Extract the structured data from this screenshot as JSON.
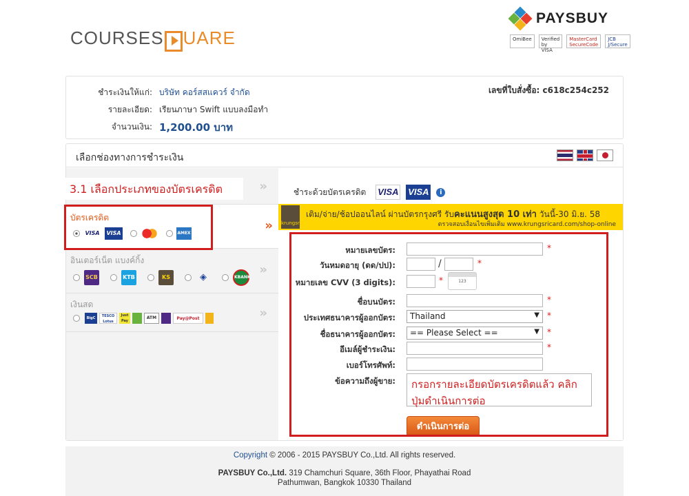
{
  "header": {
    "site_logo_main": "COURSES",
    "site_logo_rest": "UARE",
    "gateway_brand": "PAYSBUY",
    "badges": [
      "OmiBee",
      "Verified by VISA",
      "MasterCard SecureCode",
      "JCB J/Secure"
    ]
  },
  "order": {
    "payee_label": "ชำระเงินให้แก่:",
    "payee_value": "บริษัท คอร์สสแควร์ จำกัด",
    "detail_label": "รายละเอียด:",
    "detail_value": "เรียนภาษา Swift แบบลงมือทำ",
    "amount_label": "จำนวนเงิน:",
    "amount_value": "1,200.00 บาท",
    "order_no": "เลขที่ใบสั่งซื้อ: c618c254c252"
  },
  "panel": {
    "title": "เลือกช่องทางการชำระเงิน",
    "annotation_step": "3.1 เลือกประเภทของบัตรเครดิต",
    "credit_card_head": "บัตรเครดิต",
    "internet_banking_head": "อินเตอร์เน็ต แบงค์กิ้ง",
    "cash_head": "เงินสด",
    "card_logos": [
      "VISA",
      "VISA",
      "MC",
      "AMEX"
    ],
    "bank_logos": [
      "SCB",
      "KTB",
      "KS",
      "BBL",
      "KBANK"
    ],
    "cash_logos": [
      "BigC",
      "TESCO Lotus",
      "Just Pay",
      "ATM",
      "Pay@Post"
    ]
  },
  "content": {
    "pay_with": "ชำระด้วยบัตรเครดิต",
    "visa_label": "VISA",
    "banner_line1": "เติม/จ่าย/ช้อปออนไลน์ ผ่านบัตรกรุงศรี รับ",
    "banner_bold": "คะแนนสูงสุด 10 เท่า",
    "banner_line1_tail": " วันนี้-30 มิ.ย. 58",
    "banner_line2": "ตรวจสอบเงื่อนไขเพิ่มเติม www.krungsricard.com/shop-online",
    "banner_logo": "krungsri"
  },
  "form": {
    "card_number_label": "หมายเลขบัตร:",
    "expiry_label": "วันหมดอายุ (ดด/ปป):",
    "cvv_label": "หมายเลข CVV (3 digits):",
    "name_label": "ชื่อบนบัตร:",
    "issuer_country_label": "ประเทศธนาคารผู้ออกบัตร:",
    "issuer_country_value": "Thailand",
    "issuer_bank_label": "ชื่อธนาคารผู้ออกบัตร:",
    "issuer_bank_value": "== Please Select ==",
    "email_label": "อีเมล์ผู้ชำระเงิน:",
    "phone_label": "เบอร์โทรศัพท์:",
    "message_label": "ข้อความถึงผู้ขาย:",
    "annotation_text": "กรอกรายละเอียดบัตรเครดิตแล้ว คลิกปุ่มดำเนินการต่อ",
    "submit_label": "ดำเนินการต่อ",
    "required_mark": "*",
    "slash": "/"
  },
  "footer": {
    "copyright_link": "Copyright",
    "copyright_text": " © 2006 - 2015 PAYSBUY Co.,Ltd. All rights reserved.",
    "company": "PAYSBUY Co.,Ltd.",
    "address1": " 319 Chamchuri Square, 36th Floor, Phayathai Road",
    "address2": "Pathumwan, Bangkok 10330 Thailand"
  },
  "colors": {
    "accent_orange": "#e98b2a",
    "annotation_red": "#d01e1e",
    "link_blue": "#1f4f8f",
    "banner_yellow": "#ffd500"
  }
}
